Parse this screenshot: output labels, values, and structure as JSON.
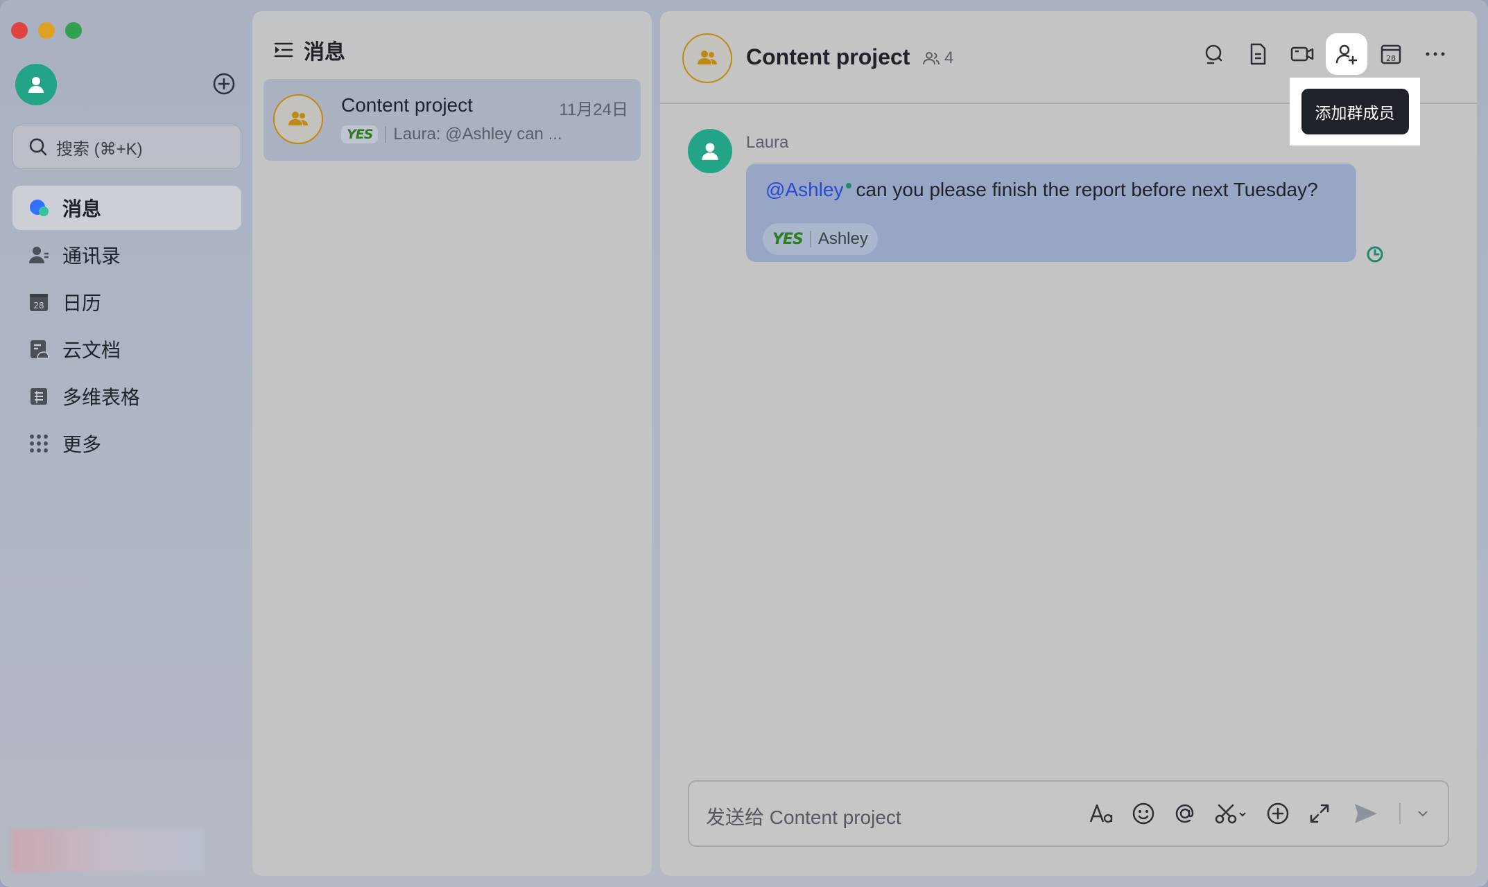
{
  "window": {
    "traffic_lights": [
      "close",
      "minimize",
      "maximize"
    ]
  },
  "sidebar": {
    "search_placeholder": "搜索 (⌘+K)",
    "items": [
      {
        "label": "消息",
        "icon": "messages-icon",
        "active": true
      },
      {
        "label": "通讯录",
        "icon": "contacts-icon",
        "active": false
      },
      {
        "label": "日历",
        "icon": "calendar-icon",
        "active": false
      },
      {
        "label": "云文档",
        "icon": "docs-icon",
        "active": false
      },
      {
        "label": "多维表格",
        "icon": "base-table-icon",
        "active": false
      },
      {
        "label": "更多",
        "icon": "more-apps-icon",
        "active": false
      }
    ],
    "calendar_day": "28"
  },
  "chat_list": {
    "title": "消息",
    "chats": [
      {
        "name": "Content project",
        "date": "11月24日",
        "tag": "YES",
        "preview": "Laura: @Ashley can ..."
      }
    ]
  },
  "chat": {
    "title": "Content project",
    "member_count": "4",
    "toolbar": [
      "search-icon",
      "doc-icon",
      "video-call-icon",
      "add-member-icon",
      "calendar-icon",
      "more-icon"
    ],
    "toolbar_calendar_day": "28",
    "tooltip": "添加群成员",
    "messages": [
      {
        "sender": "Laura",
        "mention": "@Ashley",
        "text": "can you please finish the report before next Tuesday?",
        "reaction_tag": "YES",
        "reaction_user": "Ashley"
      }
    ],
    "composer_placeholder": "发送给 Content project",
    "composer_tools": [
      "text-format-icon",
      "emoji-icon",
      "mention-icon",
      "screenshot-icon",
      "add-icon",
      "expand-icon",
      "send-icon",
      "dropdown-icon"
    ]
  },
  "colors": {
    "accent_avatar": "#24a487",
    "group_ring": "#c08a12",
    "mention": "#2849d4",
    "bubble": "#97a6c4"
  }
}
